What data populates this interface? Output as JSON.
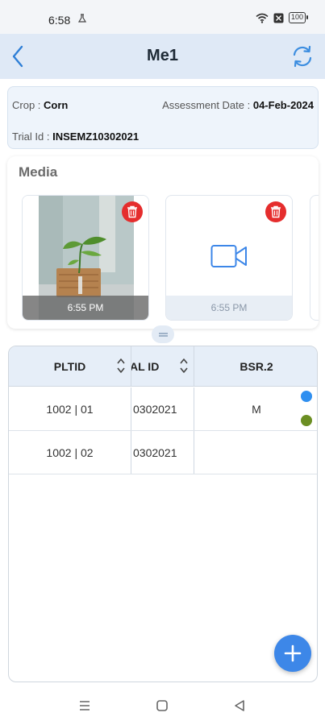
{
  "status_bar": {
    "time": "6:58",
    "battery": "100"
  },
  "header": {
    "title": "Me1"
  },
  "info": {
    "crop_label": "Crop : ",
    "crop_value": "Corn",
    "date_label": "Assessment Date : ",
    "date_value": "04-Feb-2024",
    "trial_label": "Trial Id : ",
    "trial_value": "INSEMZ10302021"
  },
  "media": {
    "title": "Media",
    "items": [
      {
        "type": "photo",
        "time": "6:55 PM"
      },
      {
        "type": "video",
        "time": "6:55 PM"
      }
    ]
  },
  "table": {
    "columns": [
      "PLTID",
      "AL ID",
      "BSR.2"
    ],
    "rows": [
      {
        "pltid": "1002 | 01",
        "trial_id": "0302021",
        "bsr2": "M"
      },
      {
        "pltid": "1002 | 02",
        "trial_id": "0302021",
        "bsr2": ""
      }
    ]
  },
  "colors": {
    "accent": "#3d87e8",
    "delete": "#e52d2d",
    "dot_blue": "#2f8ff0",
    "dot_green": "#6b8e23"
  }
}
